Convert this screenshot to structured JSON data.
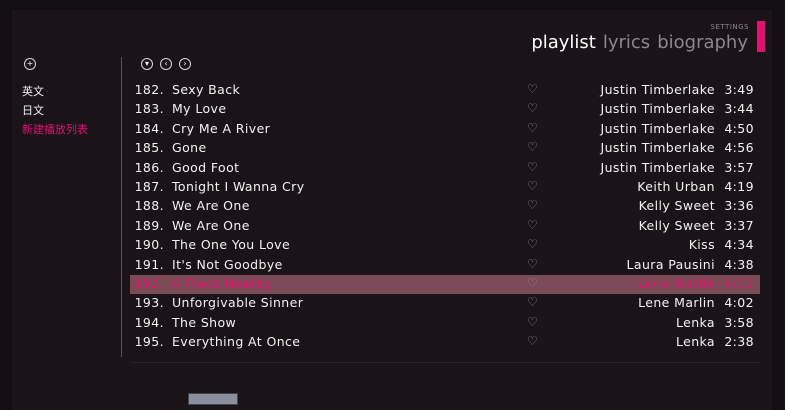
{
  "header": {
    "settings_label": "SETTINGS",
    "tabs": [
      {
        "label": "playlist",
        "active": true
      },
      {
        "label": "lyrics",
        "active": false
      },
      {
        "label": "biography",
        "active": false
      }
    ],
    "accent_color": "#e0126d"
  },
  "controls": {
    "add_icon": "+",
    "down_icon": "▾",
    "back_icon": "‹",
    "forward_icon": "›"
  },
  "sidebar": {
    "items": [
      {
        "label": "英文"
      },
      {
        "label": "日文"
      },
      {
        "label": "新建播放列表"
      }
    ]
  },
  "tracks": [
    {
      "num": "182.",
      "title": "Sexy Back",
      "artist": "Justin Timberlake",
      "duration": "3:49"
    },
    {
      "num": "183.",
      "title": "My Love",
      "artist": "Justin Timberlake",
      "duration": "3:44"
    },
    {
      "num": "184.",
      "title": "Cry Me A River",
      "artist": "Justin Timberlake",
      "duration": "4:50"
    },
    {
      "num": "185.",
      "title": "Gone",
      "artist": "Justin Timberlake",
      "duration": "4:56"
    },
    {
      "num": "186.",
      "title": "Good Foot",
      "artist": "Justin Timberlake",
      "duration": "3:57"
    },
    {
      "num": "187.",
      "title": "Tonight I Wanna Cry",
      "artist": "Keith Urban",
      "duration": "4:19"
    },
    {
      "num": "188.",
      "title": "We Are One",
      "artist": "Kelly Sweet",
      "duration": "3:36"
    },
    {
      "num": "189.",
      "title": "We Are One",
      "artist": "Kelly Sweet",
      "duration": "3:37"
    },
    {
      "num": "190.",
      "title": "The One You Love",
      "artist": "Kiss",
      "duration": "4:34"
    },
    {
      "num": "191.",
      "title": "It's Not Goodbye",
      "artist": "Laura Pausini",
      "duration": "4:38"
    },
    {
      "num": "192.",
      "title": "A Place Nearby",
      "artist": "Lene Marlin",
      "duration": "4:11",
      "selected": true
    },
    {
      "num": "193.",
      "title": "Unforgivable Sinner",
      "artist": "Lene Marlin",
      "duration": "4:02"
    },
    {
      "num": "194.",
      "title": "The Show",
      "artist": "Lenka",
      "duration": "3:58"
    },
    {
      "num": "195.",
      "title": "Everything At Once",
      "artist": "Lenka",
      "duration": "2:38"
    }
  ],
  "heart_icon": "♡"
}
